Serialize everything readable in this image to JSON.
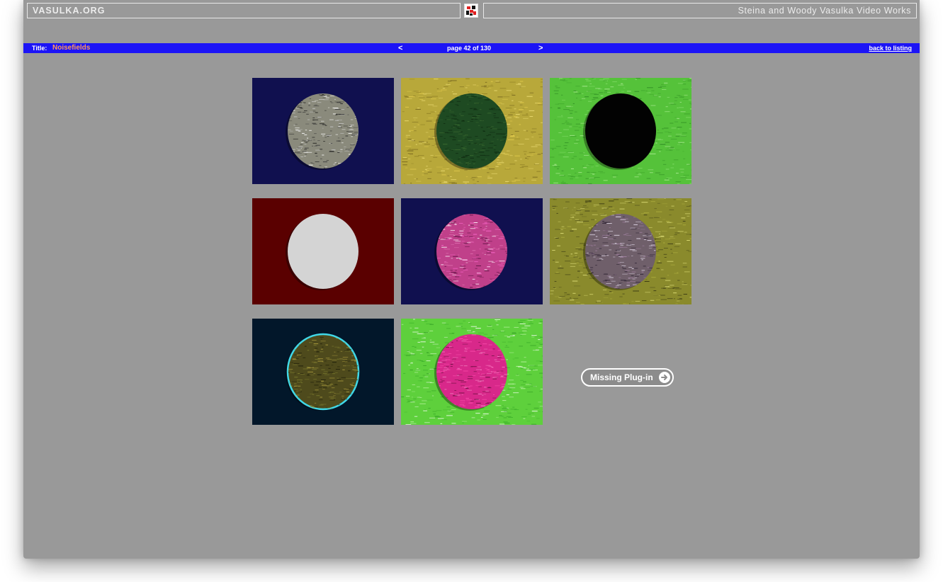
{
  "header": {
    "site_name": "VASULKA.ORG",
    "tagline": "Steina and Woody Vasulka Video Works"
  },
  "navbar": {
    "title_label": "Title:",
    "title": "Noisefields",
    "prev": "<",
    "page_info": "page 42 of 130",
    "next": ">",
    "back": "back to listing"
  },
  "thumbnails": [
    {
      "bg": "#10104f",
      "disc": "#8a8a7c",
      "noise": "bw",
      "alt": "noise disc on navy"
    },
    {
      "bg": "#b8a83a",
      "disc": "#1e4a22",
      "noise": "yellow",
      "alt": "green disc on gold noise"
    },
    {
      "bg": "#55c23a",
      "disc": "#020202",
      "noise": "green",
      "alt": "black disc on green noise"
    },
    {
      "bg": "#5a0000",
      "disc": "#d4d4d4",
      "noise": "none",
      "alt": "white disc on maroon"
    },
    {
      "bg": "#10104f",
      "disc": "#c0408a",
      "noise": "pink",
      "alt": "pink noise disc on navy"
    },
    {
      "bg": "#8a8a2c",
      "disc": "#6f5f6a",
      "noise": "olive",
      "alt": "purple noise disc on olive"
    },
    {
      "bg": "#02172a",
      "disc": "#4e4a1c",
      "noise": "olive-dark",
      "alt": "olive disc with cyan rim on dark"
    },
    {
      "bg": "#5ed03c",
      "disc": "#d8288a",
      "noise": "magenta",
      "alt": "magenta disc on green noise"
    }
  ],
  "plugin": {
    "label": "Missing Plug-in",
    "icon": "arrow-right-circle-icon"
  },
  "colors": {
    "page_bg": "#999999",
    "navbar_bg": "#1c14f6",
    "title_color": "#ff9a5a"
  }
}
